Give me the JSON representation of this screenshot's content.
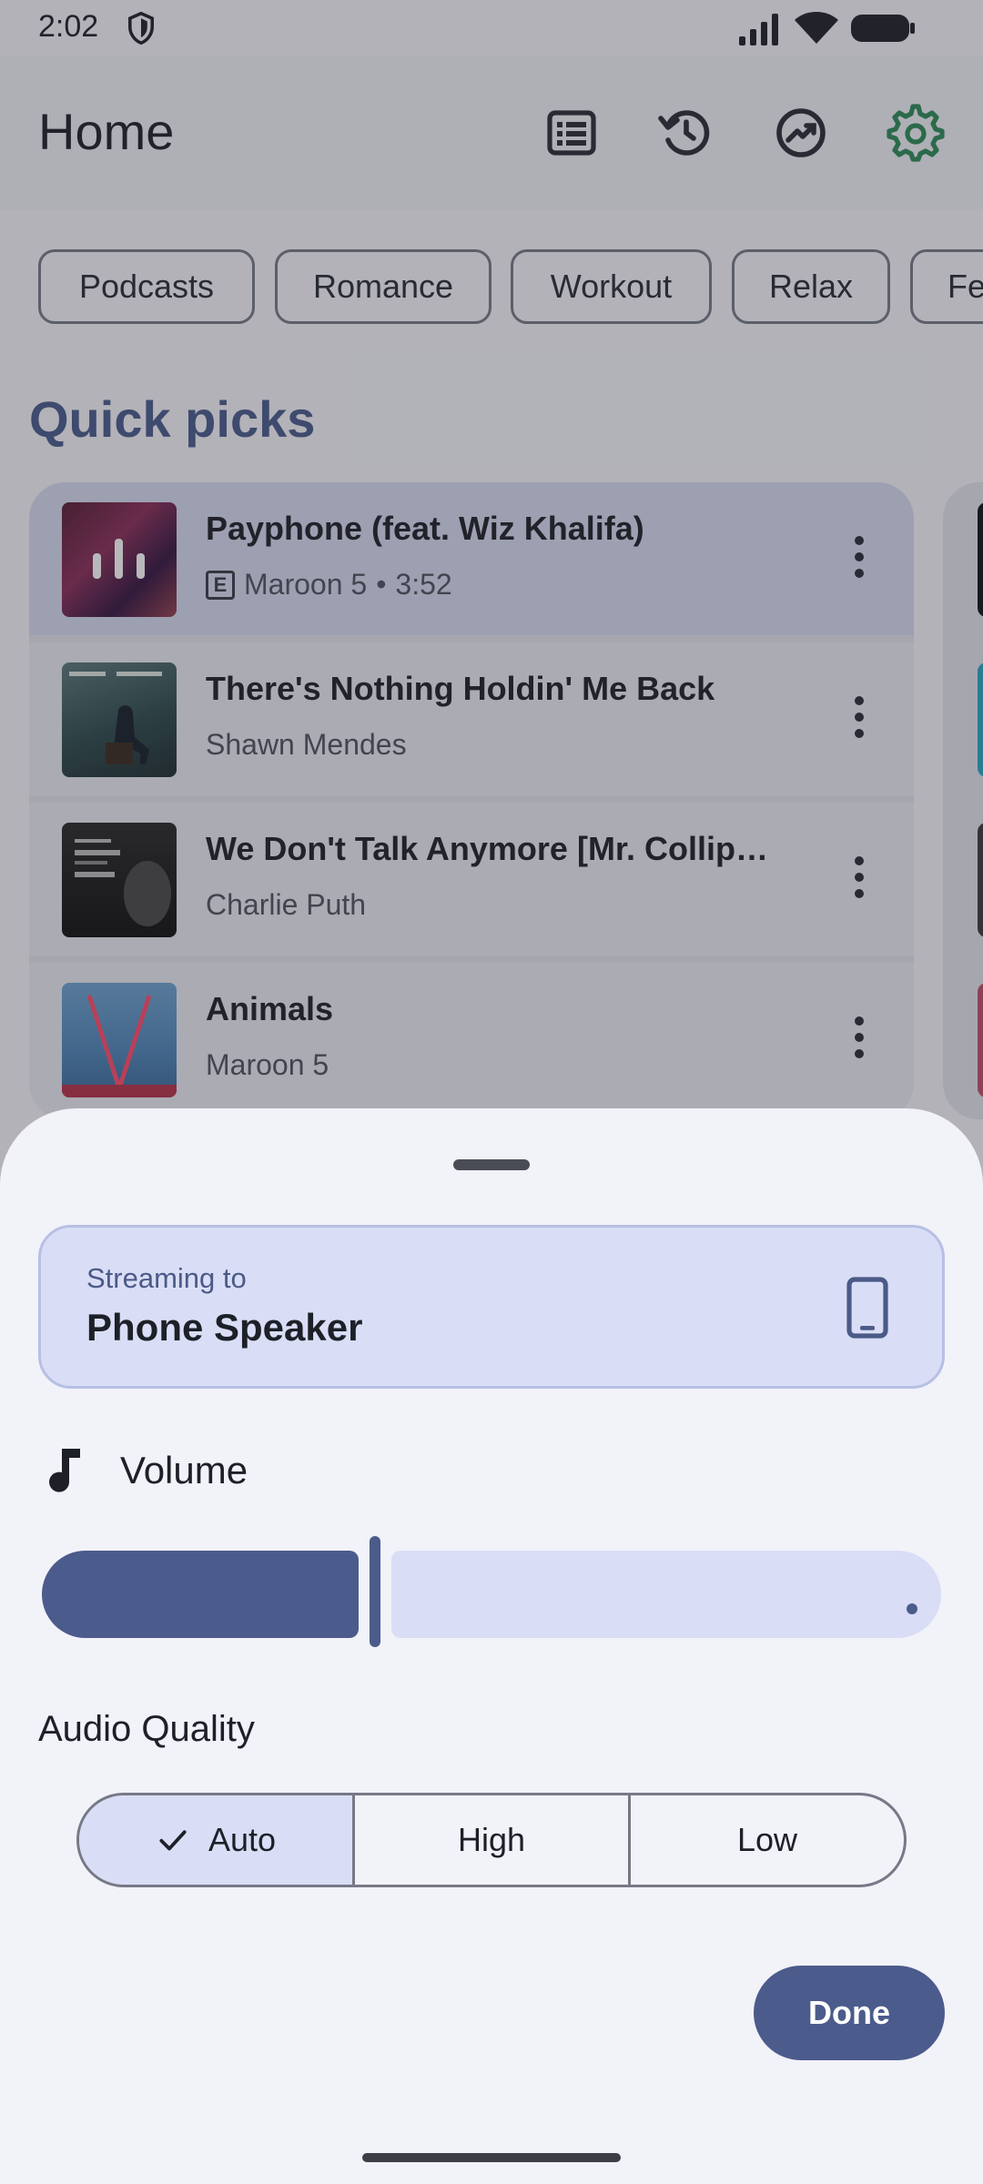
{
  "status_bar": {
    "time": "2:02"
  },
  "top_bar": {
    "title": "Home",
    "icons": [
      "library-icon",
      "history-icon",
      "stats-icon",
      "settings-icon"
    ]
  },
  "chips": [
    "Podcasts",
    "Romance",
    "Workout",
    "Relax",
    "Fe"
  ],
  "quick_picks": {
    "title": "Quick picks",
    "songs": [
      {
        "title": "Payphone (feat. Wiz Khalifa)",
        "artist": "Maroon 5",
        "explicit": true,
        "duration": "3:52",
        "playing": true
      },
      {
        "title": "There's Nothing Holdin' Me Back",
        "artist": "Shawn Mendes",
        "explicit": false
      },
      {
        "title": "We Don't Talk Anymore [Mr. Collip…",
        "artist": "Charlie Puth",
        "explicit": false
      },
      {
        "title": "Animals",
        "artist": "Maroon 5",
        "explicit": false
      }
    ]
  },
  "sheet": {
    "streaming_label": "Streaming to",
    "device": "Phone Speaker",
    "volume_label": "Volume",
    "volume_level": 0.37,
    "audio_quality_label": "Audio Quality",
    "quality_options": [
      "Auto",
      "High",
      "Low"
    ],
    "quality_selected": "Auto",
    "done_label": "Done"
  },
  "colors": {
    "accent": "#4b5b8b",
    "accent_container": "#d9def6",
    "settings_icon": "#2e8b57"
  }
}
